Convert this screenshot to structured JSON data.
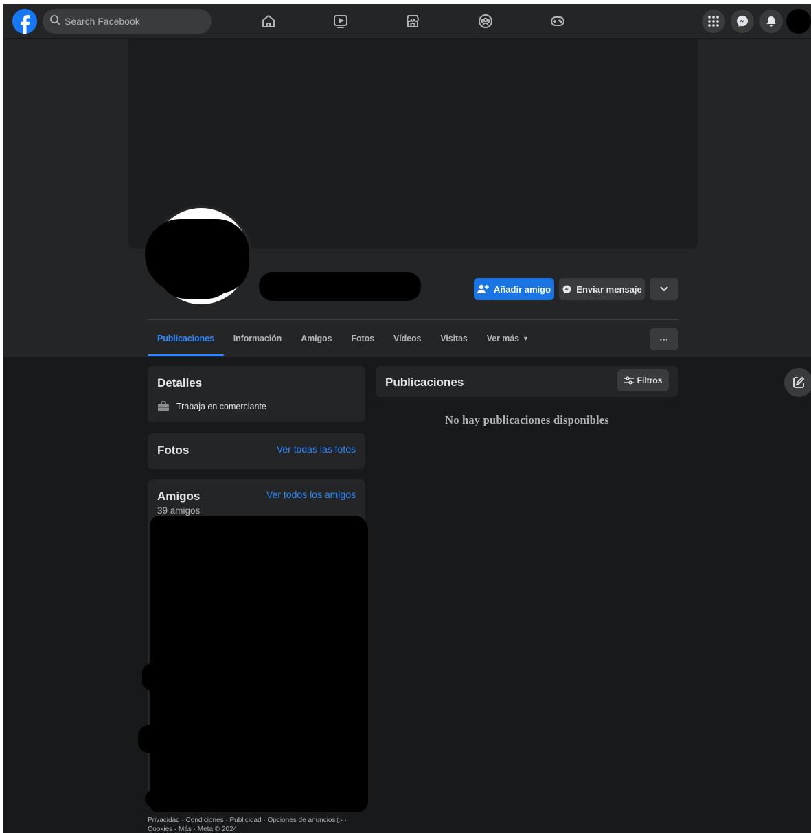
{
  "topbar": {
    "search_placeholder": "Search Facebook",
    "logo_icon": "facebook-logo-icon",
    "nav_icons": [
      "home-icon",
      "watch-icon",
      "marketplace-icon",
      "groups-icon",
      "gaming-icon"
    ],
    "right_icons": [
      "menu-grid-icon",
      "messenger-icon",
      "notifications-bell-icon"
    ]
  },
  "profile": {
    "add_friend_label": "Añadir amigo",
    "message_label": "Enviar mensaje",
    "dropdown_icon": "chevron-down-icon",
    "more_label": "···"
  },
  "tabs": [
    {
      "label": "Publicaciones",
      "active": true
    },
    {
      "label": "Información"
    },
    {
      "label": "Amigos"
    },
    {
      "label": "Fotos"
    },
    {
      "label": "Vídeos"
    },
    {
      "label": "Visitas"
    },
    {
      "label": "Ver más"
    }
  ],
  "details": {
    "title": "Detalles",
    "work": "Trabaja en comerciante"
  },
  "photos": {
    "title": "Fotos",
    "link": "Ver todas las fotos"
  },
  "friends": {
    "title": "Amigos",
    "link": "Ver todos los amigos",
    "count": "39 amigos"
  },
  "posts": {
    "title": "Publicaciones",
    "filters_label": "Filtros",
    "empty_message": "No hay publicaciones disponibles"
  },
  "footer": {
    "line1": "Privacidad · Condiciones · Publicidad · Opciones de anuncios ▷ ·",
    "line2": "Cookies · Más · Meta © 2024"
  },
  "colors": {
    "accent": "#1b74e4",
    "link": "#2d88ff",
    "background": "#18191a",
    "surface": "#242526"
  }
}
